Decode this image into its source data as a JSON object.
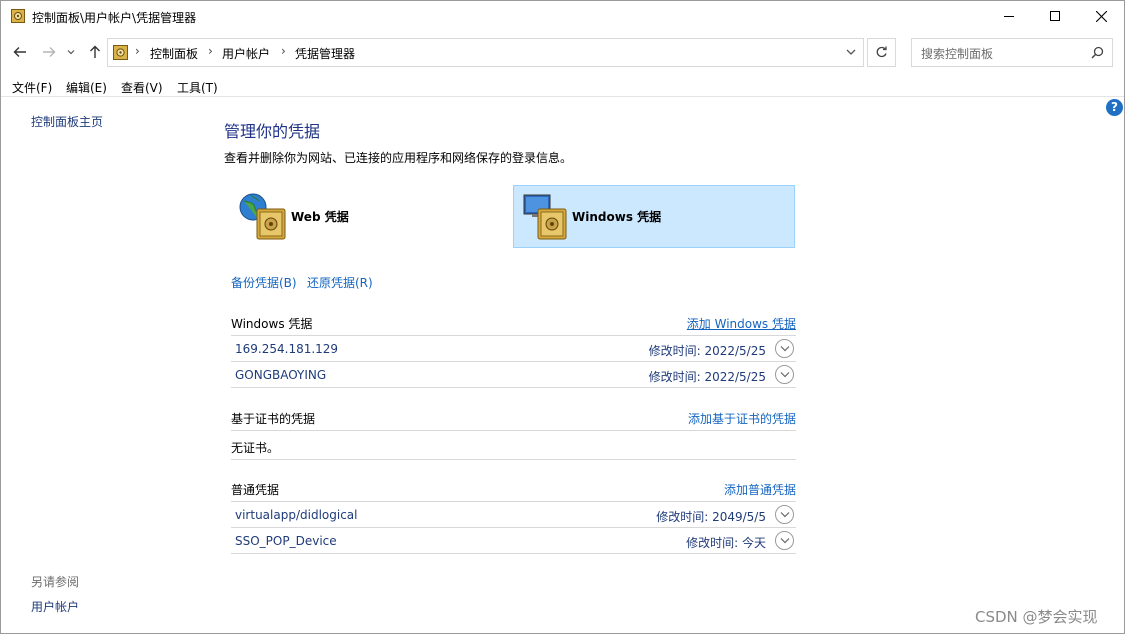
{
  "window": {
    "title": "控制面板\\用户帐户\\凭据管理器",
    "colors": {
      "accent": "#1e3287",
      "link": "#1565c0",
      "selected_tile_bg": "#cce8ff",
      "selected_tile_border": "#99d1ff",
      "help_icon": "#1f6fc5"
    }
  },
  "address": {
    "crumbs": [
      "控制面板",
      "用户帐户",
      "凭据管理器"
    ],
    "separator": "›",
    "search_placeholder": "搜索控制面板"
  },
  "menu": [
    "文件(F)",
    "编辑(E)",
    "查看(V)",
    "工具(T)"
  ],
  "help_label": "?",
  "sidebar": {
    "home": "控制面板主页",
    "see_also_title": "另请参阅",
    "see_also_link": "用户帐户"
  },
  "main": {
    "heading": "管理你的凭据",
    "description": "查看并删除你为网站、已连接的应用程序和网络保存的登录信息。",
    "tiles": {
      "web": "Web 凭据",
      "windows": "Windows 凭据"
    },
    "backup": "备份凭据(B)",
    "restore": "还原凭据(R)",
    "windows_section": {
      "title": "Windows 凭据",
      "add": "添加 Windows 凭据",
      "items": [
        {
          "name": "169.254.181.129",
          "time": "修改时间:  2022/5/25"
        },
        {
          "name": "GONGBAOYING",
          "time": "修改时间:  2022/5/25"
        }
      ]
    },
    "cert_section": {
      "title": "基于证书的凭据",
      "add": "添加基于证书的凭据",
      "empty": "无证书。"
    },
    "generic_section": {
      "title": "普通凭据",
      "add": "添加普通凭据",
      "items": [
        {
          "name": "virtualapp/didlogical",
          "time": "修改时间:  2049/5/5"
        },
        {
          "name": "SSO_POP_Device",
          "time": "修改时间:  今天"
        }
      ]
    }
  },
  "watermark": "CSDN @梦会实现"
}
